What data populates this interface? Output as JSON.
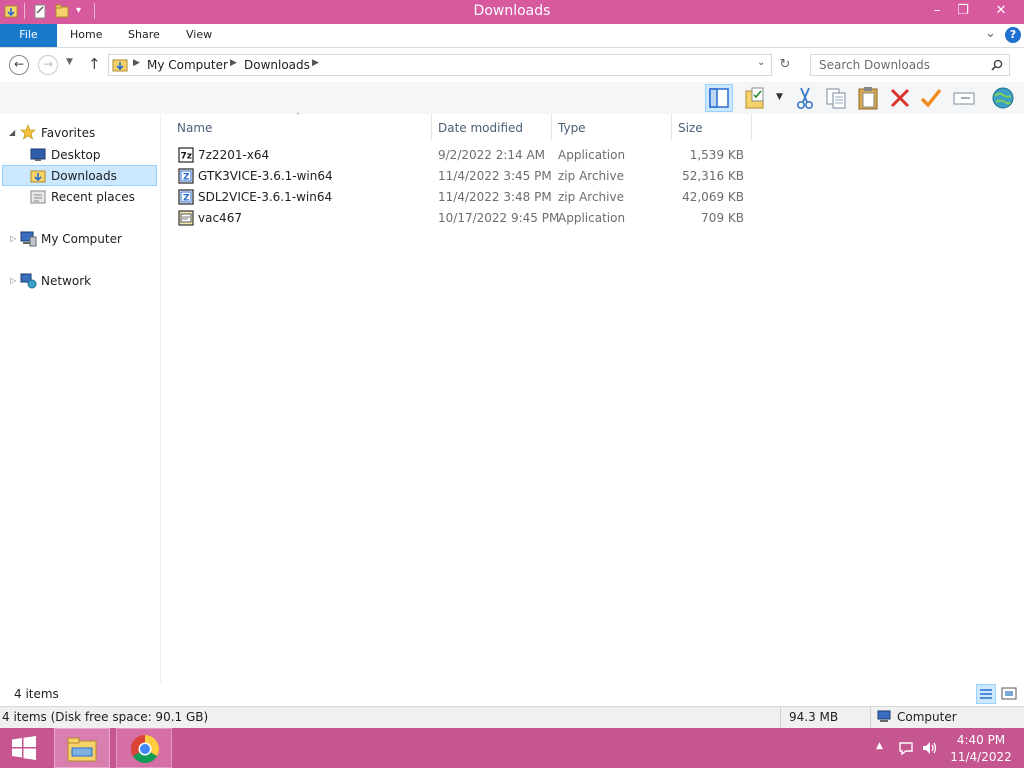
{
  "window": {
    "title": "Downloads",
    "minimize": "–",
    "restore": "❐",
    "close": "✕"
  },
  "ribbon": {
    "file_tab": "File",
    "tabs": [
      "Home",
      "Share",
      "View"
    ],
    "collapse": "⌄",
    "help": "?"
  },
  "address": {
    "path": [
      "My Computer",
      "Downloads"
    ],
    "search_placeholder": "Search Downloads"
  },
  "toolbar": {
    "icons": [
      "preview-pane-icon",
      "properties-icon",
      "cut-icon",
      "copy-icon",
      "paste-icon",
      "delete-icon",
      "check-icon",
      "rename-icon",
      "globe-icon"
    ]
  },
  "nav": {
    "favorites": "Favorites",
    "desktop": "Desktop",
    "downloads": "Downloads",
    "recent_places": "Recent places",
    "my_computer": "My Computer",
    "network": "Network"
  },
  "columns": {
    "name": "Name",
    "date": "Date modified",
    "type": "Type",
    "size": "Size"
  },
  "files": [
    {
      "name": "7z2201-x64",
      "date": "9/2/2022 2:14 AM",
      "type": "Application",
      "size": "1,539 KB",
      "icon": "app-7z-icon"
    },
    {
      "name": "GTK3VICE-3.6.1-win64",
      "date": "11/4/2022 3:45 PM",
      "type": "zip Archive",
      "size": "52,316 KB",
      "icon": "zip-icon"
    },
    {
      "name": "SDL2VICE-3.6.1-win64",
      "date": "11/4/2022 3:48 PM",
      "type": "zip Archive",
      "size": "42,069 KB",
      "icon": "zip-icon"
    },
    {
      "name": "vac467",
      "date": "10/17/2022 9:45 PM",
      "type": "Application",
      "size": "709 KB",
      "icon": "app-icon"
    }
  ],
  "status": {
    "item_count": "4 items",
    "disk_info": "4 items (Disk free space: 90.1 GB)",
    "size_total": "94.3 MB",
    "location": "Computer"
  },
  "taskbar": {
    "time": "4:40 PM",
    "date": "11/4/2022",
    "show_hidden": "▲"
  },
  "colors": {
    "title_bar": "#d85a9e",
    "taskbar": "#c6568f",
    "file_tab": "#1979ca",
    "selection": "#cce8ff"
  }
}
